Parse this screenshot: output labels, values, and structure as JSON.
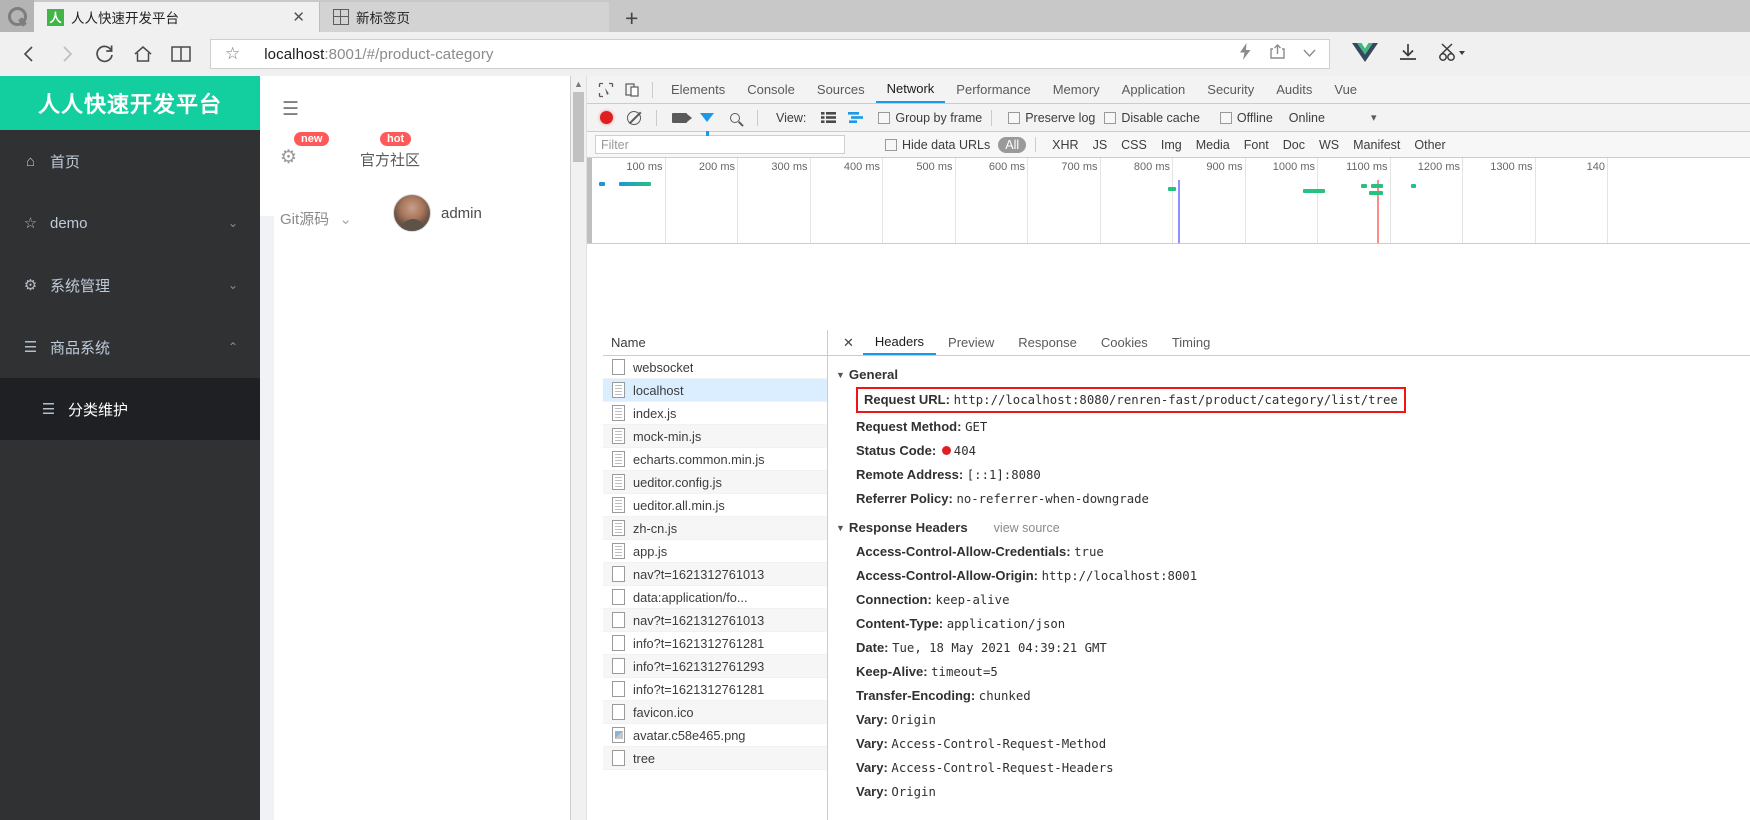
{
  "browser": {
    "tabs": [
      {
        "title": "人人快速开发平台",
        "favicon": "renren-icon",
        "active": true,
        "close_label": "✕"
      },
      {
        "title": "新标签页",
        "favicon": "grid-icon",
        "active": false
      }
    ],
    "new_tab_label": "+",
    "nav": {
      "back": "‹",
      "forward": "›",
      "reload": "⟳",
      "home": "⌂",
      "reader": "book-icon",
      "star": "☆"
    },
    "url": {
      "host": "localhost",
      "rest": ":8001/#/product-category"
    },
    "url_icons": [
      "lightning-icon",
      "share-icon",
      "chevron-down-icon"
    ],
    "extensions": [
      "vue-devtools-icon",
      "download-icon",
      "snip-icon"
    ]
  },
  "app": {
    "brand": "人人快速开发平台",
    "menu": [
      {
        "label": "首页",
        "icon": "home-icon",
        "arrow": "",
        "sub": false
      },
      {
        "label": "demo",
        "icon": "star-icon",
        "arrow": "⌄",
        "sub": false
      },
      {
        "label": "系统管理",
        "icon": "gear-icon",
        "arrow": "⌄",
        "sub": false
      },
      {
        "label": "商品系统",
        "icon": "menu-icon",
        "arrow": "⌃",
        "sub": false
      },
      {
        "label": "分类维护",
        "icon": "list-icon",
        "arrow": "",
        "sub": true
      }
    ],
    "topbar": {
      "hamburger": "☰",
      "gear": "gear-icon",
      "badge_new": "new",
      "badge_hot": "hot",
      "community": "官方社区",
      "git_source": "Git源码",
      "git_caret": "⌄",
      "username": "admin"
    }
  },
  "devtools": {
    "panels": [
      "Elements",
      "Console",
      "Sources",
      "Network",
      "Performance",
      "Memory",
      "Application",
      "Security",
      "Audits",
      "Vue"
    ],
    "active_panel": "Network",
    "controls": {
      "record": "record-button",
      "clear": "clear-button",
      "camera": "capture-screenshots-button",
      "filter": "filter-button",
      "search": "search-button",
      "view_label": "View:",
      "checkboxes": [
        {
          "label": "Group by frame",
          "checked": false
        },
        {
          "label": "Preserve log",
          "checked": false
        },
        {
          "label": "Disable cache",
          "checked": false
        },
        {
          "label": "Offline",
          "checked": false
        }
      ],
      "throttling": "Online",
      "throttling_caret": "▾"
    },
    "filter_bar": {
      "placeholder": "Filter",
      "value": "",
      "hide_data_urls": "Hide data URLs",
      "hide_data_urls_checked": false,
      "types": [
        "All",
        "XHR",
        "JS",
        "CSS",
        "Img",
        "Media",
        "Font",
        "Doc",
        "WS",
        "Manifest",
        "Other"
      ],
      "selected_type": "All"
    },
    "overview": {
      "ticks": [
        "100 ms",
        "200 ms",
        "300 ms",
        "400 ms",
        "500 ms",
        "600 ms",
        "700 ms",
        "800 ms",
        "900 ms",
        "1000 ms",
        "1100 ms",
        "1200 ms",
        "1300 ms",
        "140"
      ],
      "dom_content_loaded_color": "#6a6aff",
      "load_color": "#ff6a6a",
      "bar_color": "#26c281"
    },
    "requests": {
      "column_header": "Name",
      "rows": [
        {
          "name": "websocket",
          "icon": "blank-doc-icon",
          "selected": false
        },
        {
          "name": "localhost",
          "icon": "doc-icon",
          "selected": true
        },
        {
          "name": "index.js",
          "icon": "doc-icon",
          "selected": false
        },
        {
          "name": "mock-min.js",
          "icon": "doc-icon",
          "selected": false
        },
        {
          "name": "echarts.common.min.js",
          "icon": "doc-icon",
          "selected": false
        },
        {
          "name": "ueditor.config.js",
          "icon": "doc-icon",
          "selected": false
        },
        {
          "name": "ueditor.all.min.js",
          "icon": "doc-icon",
          "selected": false
        },
        {
          "name": "zh-cn.js",
          "icon": "doc-icon",
          "selected": false
        },
        {
          "name": "app.js",
          "icon": "doc-icon",
          "selected": false
        },
        {
          "name": "nav?t=1621312761013",
          "icon": "blank-doc-icon",
          "selected": false
        },
        {
          "name": "data:application/fo...",
          "icon": "blank-doc-icon",
          "selected": false
        },
        {
          "name": "nav?t=1621312761013",
          "icon": "blank-doc-icon",
          "selected": false
        },
        {
          "name": "info?t=1621312761281",
          "icon": "blank-doc-icon",
          "selected": false
        },
        {
          "name": "info?t=1621312761293",
          "icon": "blank-doc-icon",
          "selected": false
        },
        {
          "name": "info?t=1621312761281",
          "icon": "blank-doc-icon",
          "selected": false
        },
        {
          "name": "favicon.ico",
          "icon": "blank-doc-icon",
          "selected": false
        },
        {
          "name": "avatar.c58e465.png",
          "icon": "image-icon",
          "selected": false
        },
        {
          "name": "tree",
          "icon": "blank-doc-icon",
          "selected": false
        }
      ]
    },
    "detail": {
      "close": "✕",
      "tabs": [
        "Headers",
        "Preview",
        "Response",
        "Cookies",
        "Timing"
      ],
      "active_tab": "Headers",
      "general_title": "General",
      "general": [
        {
          "key": "Request URL:",
          "value": "http://localhost:8080/renren-fast/product/category/list/tree",
          "highlight": true
        },
        {
          "key": "Request Method:",
          "value": "GET",
          "highlight": false
        },
        {
          "key": "Status Code:",
          "value": "404",
          "highlight": false,
          "status_dot": true
        },
        {
          "key": "Remote Address:",
          "value": "[::1]:8080",
          "highlight": false
        },
        {
          "key": "Referrer Policy:",
          "value": "no-referrer-when-downgrade",
          "highlight": false
        }
      ],
      "response_headers_title": "Response Headers",
      "view_source": "view source",
      "response_headers": [
        {
          "key": "Access-Control-Allow-Credentials:",
          "value": "true"
        },
        {
          "key": "Access-Control-Allow-Origin:",
          "value": "http://localhost:8001"
        },
        {
          "key": "Connection:",
          "value": "keep-alive"
        },
        {
          "key": "Content-Type:",
          "value": "application/json"
        },
        {
          "key": "Date:",
          "value": "Tue, 18 May 2021 04:39:21 GMT"
        },
        {
          "key": "Keep-Alive:",
          "value": "timeout=5"
        },
        {
          "key": "Transfer-Encoding:",
          "value": "chunked"
        },
        {
          "key": "Vary:",
          "value": "Origin"
        },
        {
          "key": "Vary:",
          "value": "Access-Control-Request-Method"
        },
        {
          "key": "Vary:",
          "value": "Access-Control-Request-Headers"
        },
        {
          "key": "Vary:",
          "value": "Origin"
        }
      ]
    }
  },
  "colors": {
    "brand_green": "#13ce9e",
    "sidebar_dark": "#303133",
    "accent_blue": "#1a9ae6",
    "error_red": "#f21414",
    "badge_red": "#ff5a5a"
  }
}
